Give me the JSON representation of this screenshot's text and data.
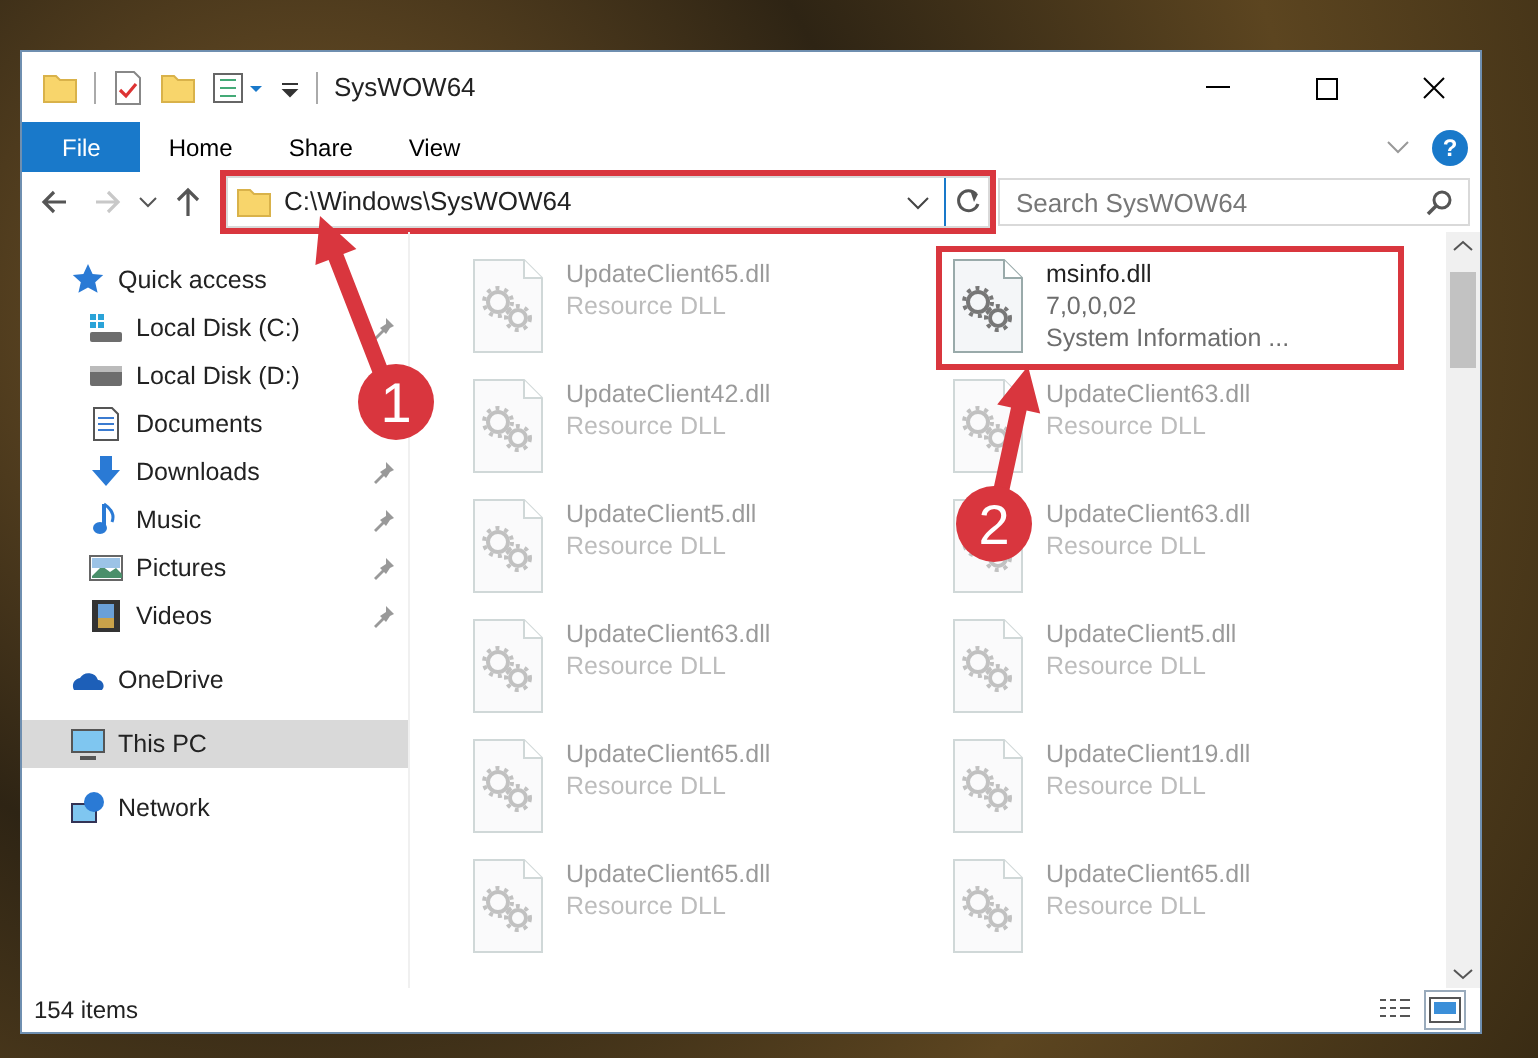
{
  "window": {
    "title": "SysWOW64"
  },
  "ribbon_tabs": [
    {
      "label": "File",
      "selected": true
    },
    {
      "label": "Home",
      "selected": false
    },
    {
      "label": "Share",
      "selected": false
    },
    {
      "label": "View",
      "selected": false
    }
  ],
  "help": "?",
  "nav_buttons": [
    {
      "kind": "back",
      "disabled": false
    },
    {
      "kind": "forward",
      "disabled": true
    },
    {
      "kind": "recent",
      "disabled": false
    },
    {
      "kind": "up",
      "disabled": false
    }
  ],
  "address_bar": {
    "path": "C:\\Windows\\SysWOW64",
    "highlighted": true
  },
  "search": {
    "placeholder": "Search SysWOW64"
  },
  "sidebar": {
    "items": [
      {
        "label": "Quick access",
        "kind": "star",
        "selected": false,
        "children": [
          {
            "label": "Local Disk (C:)",
            "kind": "system-drive",
            "pinned": true,
            "selected": false
          },
          {
            "label": "Local Disk (D:)",
            "kind": "drive",
            "pinned": false,
            "selected": false
          },
          {
            "label": "Documents",
            "kind": "documents",
            "pinned": false,
            "selected": false
          },
          {
            "label": "Downloads",
            "kind": "downloads",
            "pinned": true,
            "selected": false
          },
          {
            "label": "Music",
            "kind": "music",
            "pinned": true,
            "selected": false
          },
          {
            "label": "Pictures",
            "kind": "pictures",
            "pinned": true,
            "selected": false
          },
          {
            "label": "Videos",
            "kind": "videos",
            "pinned": true,
            "selected": false
          }
        ]
      },
      {
        "label": "OneDrive",
        "kind": "cloud",
        "selected": false
      },
      {
        "label": "This PC",
        "kind": "pc",
        "selected": true
      },
      {
        "label": "Network",
        "kind": "network",
        "selected": false
      }
    ]
  },
  "files": [
    {
      "name": "UpdateClient65.dll",
      "detail": "Resource DLL",
      "blurred": true,
      "highlighted": false
    },
    {
      "name": "msinfo.dll",
      "detail": "7,0,0,02",
      "description": "System Information ...",
      "blurred": false,
      "highlighted": true
    },
    {
      "name": "UpdateClient42.dll",
      "detail": "Resource DLL",
      "blurred": true,
      "highlighted": false
    },
    {
      "name": "UpdateClient63.dll",
      "detail": "Resource DLL",
      "blurred": true,
      "highlighted": false
    },
    {
      "name": "UpdateClient5.dll",
      "detail": "Resource DLL",
      "blurred": true,
      "highlighted": false
    },
    {
      "name": "UpdateClient63.dll",
      "detail": "Resource DLL",
      "blurred": true,
      "highlighted": false
    },
    {
      "name": "UpdateClient63.dll",
      "detail": "Resource DLL",
      "blurred": true,
      "highlighted": false
    },
    {
      "name": "UpdateClient5.dll",
      "detail": "Resource DLL",
      "blurred": true,
      "highlighted": false
    },
    {
      "name": "UpdateClient65.dll",
      "detail": "Resource DLL",
      "blurred": true,
      "highlighted": false
    },
    {
      "name": "UpdateClient19.dll",
      "detail": "Resource DLL",
      "blurred": true,
      "highlighted": false
    },
    {
      "name": "UpdateClient65.dll",
      "detail": "Resource DLL",
      "blurred": true,
      "highlighted": false
    },
    {
      "name": "UpdateClient65.dll",
      "detail": "Resource DLL",
      "blurred": true,
      "highlighted": false
    }
  ],
  "status_bar": {
    "item_count": "154 items",
    "view_buttons": [
      {
        "kind": "details",
        "selected": false
      },
      {
        "kind": "large-icons",
        "selected": true
      }
    ]
  },
  "annotations": [
    {
      "label": "1"
    },
    {
      "label": "2"
    }
  ]
}
